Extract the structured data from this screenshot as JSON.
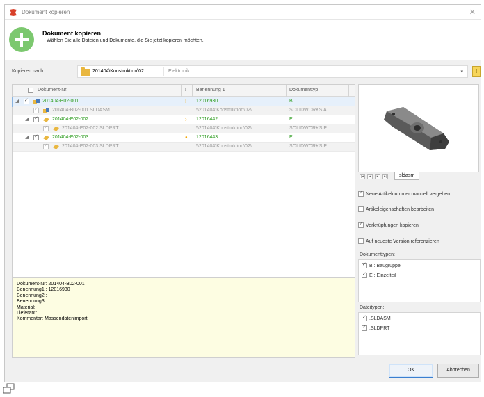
{
  "window": {
    "title": "Dokument kopieren",
    "close_icon": "close-icon"
  },
  "header": {
    "title": "Dokument kopieren",
    "subtitle": "Wählen Sie alle Dateien und Dokumente, die Sie jetzt kopieren möchten.",
    "icon": "plus-circle-icon"
  },
  "target": {
    "label": "Kopieren nach:",
    "path": "201404\\Konstruktion\\02",
    "extra": "Elektronik",
    "browse_label": "!"
  },
  "tree": {
    "columns": [
      "Dokument-Nr.",
      "!",
      "Benennung 1",
      "Dokumenttyp"
    ],
    "rows": [
      {
        "name": "201404-B02-001",
        "warn": "!",
        "benennung": "12016930",
        "typ": "B",
        "kind": "main",
        "selected": true
      },
      {
        "name": "201404-B02-001.SLDASM",
        "warn": "",
        "benennung": "\\\\201404\\Konstruktion\\02\\...",
        "typ": "SOLIDWORKS A...",
        "kind": "sub"
      },
      {
        "name": "201404-E02-002",
        "warn": "›",
        "benennung": "12016442",
        "typ": "E",
        "kind": "main"
      },
      {
        "name": "201404-E02-002.SLDPRT",
        "warn": "",
        "benennung": "\\\\201404\\Konstruktion\\02\\...",
        "typ": "SOLIDWORKS P...",
        "kind": "sub"
      },
      {
        "name": "201404-E02-003",
        "warn": "●",
        "benennung": "12016443",
        "typ": "E",
        "kind": "main"
      },
      {
        "name": "201404-E02-003.SLDPRT",
        "warn": "",
        "benennung": "\\\\201404\\Konstruktion\\02\\...",
        "typ": "SOLIDWORKS P...",
        "kind": "sub"
      }
    ]
  },
  "info": {
    "lines": [
      "Dokument-Nr: 201404-B02-001",
      "Benennung1 : 12016930",
      "Benennung2 :",
      "Benennung3 :",
      "Material:",
      "Lieferant:",
      "Kommentar:  Massendatenimport"
    ]
  },
  "preview": {
    "tab_label": "sldasm",
    "nav_icons": [
      "first-icon",
      "prev-icon",
      "next-icon",
      "last-icon"
    ]
  },
  "options": [
    {
      "label": "Neue Artikelnummer manuell vergeben",
      "checked": true
    },
    {
      "label": "Artikeleigenschaften bearbeiten",
      "checked": false
    },
    {
      "label": "Verknüpfungen kopieren",
      "checked": true
    },
    {
      "label": "Auf neueste Version referenzieren",
      "checked": false
    }
  ],
  "dokumenttypen": {
    "label": "Dokumenttypen:",
    "items": [
      {
        "label": "B : Baugruppe",
        "checked": true
      },
      {
        "label": "E : Einzelteil",
        "checked": true
      }
    ]
  },
  "dateitypen": {
    "label": "Dateitypen:",
    "items": [
      {
        "label": ".SLDASM",
        "checked": true
      },
      {
        "label": ".SLDPRT",
        "checked": true
      }
    ]
  },
  "buttons": {
    "ok": "OK",
    "cancel": "Abbrechen"
  },
  "colors": {
    "accent_green": "#2f9e22",
    "plus_green": "#7cc86f",
    "info_bg": "#fdfde2",
    "warning": "#f2a400"
  }
}
